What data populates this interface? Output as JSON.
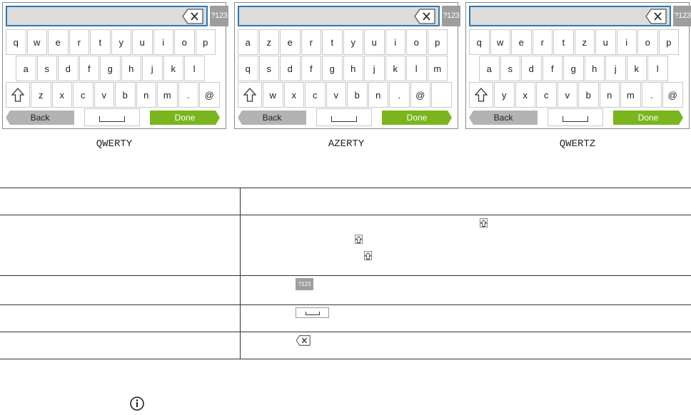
{
  "keyboards": [
    {
      "caption": "QWERTY",
      "symbols_label": "?123",
      "rows": [
        [
          "q",
          "w",
          "e",
          "r",
          "t",
          "y",
          "u",
          "i",
          "o",
          "p"
        ],
        [
          "a",
          "s",
          "d",
          "f",
          "g",
          "h",
          "j",
          "k",
          "l"
        ],
        [
          "z",
          "x",
          "c",
          "v",
          "b",
          "n",
          "m",
          ".",
          "@"
        ]
      ],
      "back_label": "Back",
      "done_label": "Done"
    },
    {
      "caption": "AZERTY",
      "symbols_label": "?123",
      "rows": [
        [
          "a",
          "z",
          "e",
          "r",
          "t",
          "y",
          "u",
          "i",
          "o",
          "p"
        ],
        [
          "q",
          "s",
          "d",
          "f",
          "g",
          "h",
          "j",
          "k",
          "l",
          "m"
        ],
        [
          "w",
          "x",
          "c",
          "v",
          "b",
          "n",
          ".",
          "@",
          ""
        ]
      ],
      "back_label": "Back",
      "done_label": "Done"
    },
    {
      "caption": "QWERTZ",
      "symbols_label": "?123",
      "rows": [
        [
          "q",
          "w",
          "e",
          "r",
          "t",
          "z",
          "u",
          "i",
          "o",
          "p"
        ],
        [
          "a",
          "s",
          "d",
          "f",
          "g",
          "h",
          "j",
          "k",
          "l"
        ],
        [
          "y",
          "x",
          "c",
          "v",
          "b",
          "n",
          "m",
          ".",
          "@"
        ]
      ],
      "back_label": "Back",
      "done_label": "Done"
    }
  ],
  "help_table": {
    "symbols_icon_label": "?123"
  },
  "colors": {
    "field_border": "#2a7ab7",
    "done_green": "#7ab51d",
    "back_gray": "#b3b3b3",
    "symbols_gray": "#9e9e9e"
  },
  "icons": [
    "backspace-icon",
    "shift-icon",
    "space-icon",
    "info-icon"
  ]
}
